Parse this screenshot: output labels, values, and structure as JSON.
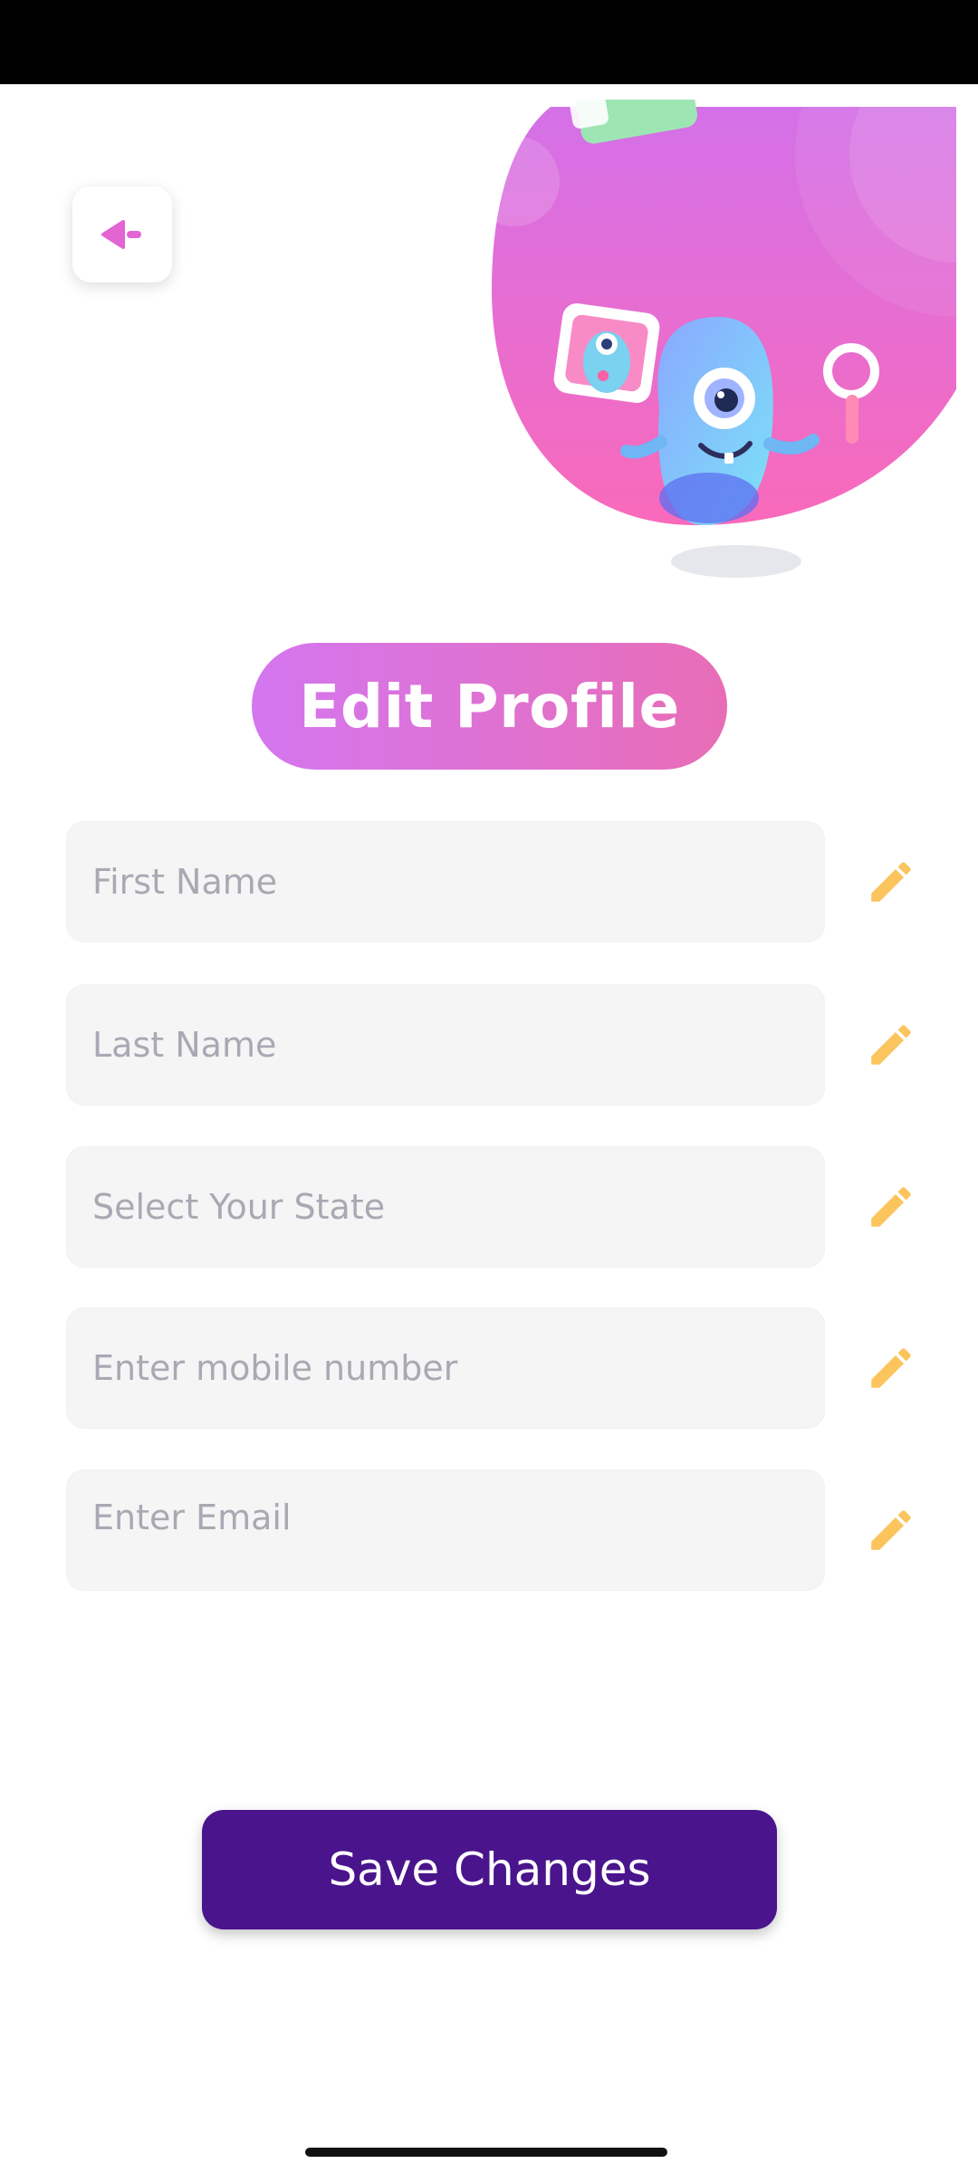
{
  "header": {
    "back_icon": "back-arrow-icon",
    "illustration": "monster-with-magnifier-illustration"
  },
  "title": "Edit Profile",
  "form": {
    "fields": [
      {
        "placeholder": "First Name",
        "value": "",
        "icon": "pencil-icon"
      },
      {
        "placeholder": "Last Name",
        "value": "",
        "icon": "pencil-icon"
      },
      {
        "placeholder": "Select Your State",
        "value": "",
        "icon": "pencil-icon"
      },
      {
        "placeholder": "Enter mobile number",
        "value": "",
        "icon": "pencil-icon"
      },
      {
        "placeholder": "Enter Email",
        "value": "",
        "icon": "pencil-icon"
      }
    ]
  },
  "save_button": {
    "label": "Save Changes"
  },
  "colors": {
    "title_gradient_start": "#d476ef",
    "title_gradient_end": "#e86db6",
    "save_button": "#4a148c",
    "edit_icon": "#fcc45c",
    "back_icon": "#e364d3",
    "field_bg": "#f5f5f5",
    "placeholder": "#a9a9b4"
  }
}
